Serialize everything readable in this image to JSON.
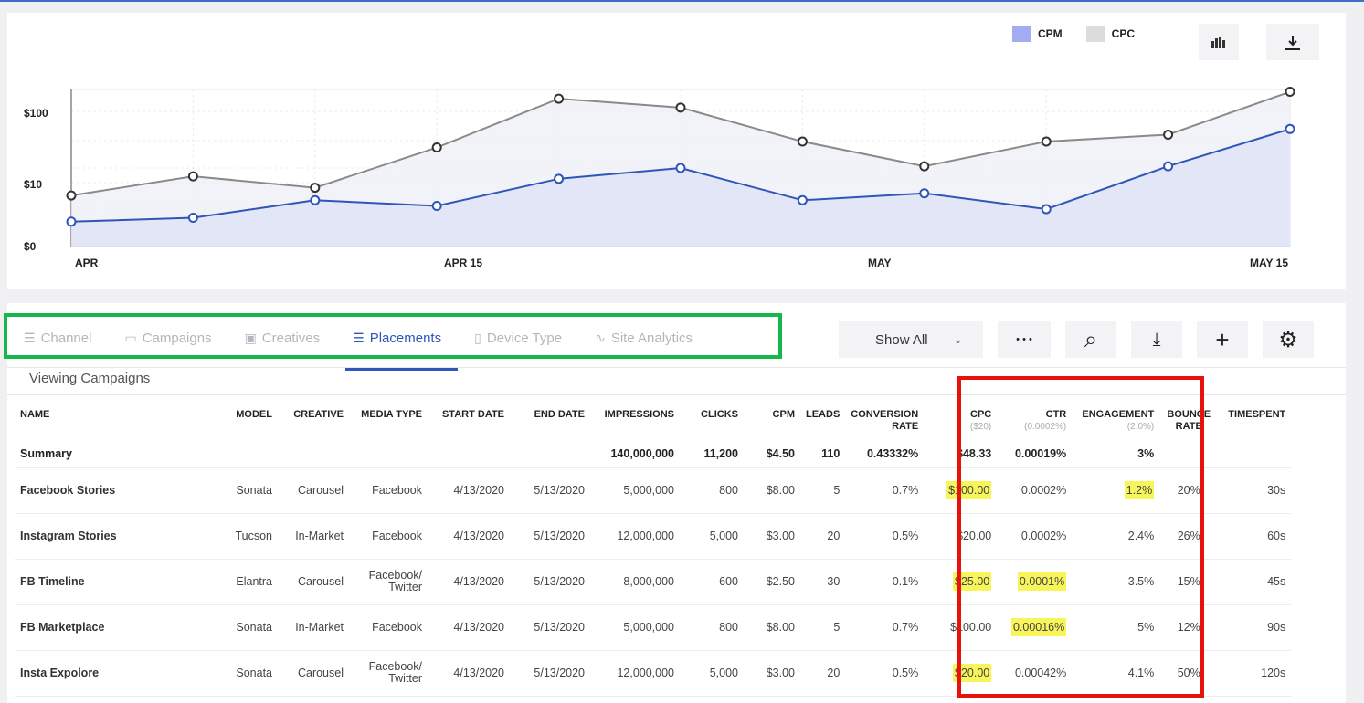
{
  "legend": [
    {
      "label": "CPM",
      "color": "#a3acf0"
    },
    {
      "label": "CPC",
      "color": "#dcdcdc"
    }
  ],
  "chart_data": {
    "type": "area",
    "x_labels": [
      "APR",
      "APR 15",
      "MAY",
      "MAY 15"
    ],
    "y_ticks": [
      "$100",
      "$10",
      "$0"
    ],
    "yscale": "log",
    "series": [
      {
        "name": "CPM",
        "color": "#2f55b8",
        "values": [
          3,
          3.4,
          6,
          5,
          12,
          17,
          6,
          7.5,
          4.5,
          18,
          60
        ]
      },
      {
        "name": "CPC",
        "color": "#8a8a8a",
        "values": [
          7,
          13,
          9,
          33,
          160,
          120,
          40,
          18,
          40,
          50,
          200
        ]
      }
    ]
  },
  "tabs": [
    {
      "label": "Channel",
      "icon": "list-icon"
    },
    {
      "label": "Campaigns",
      "icon": "folder-icon"
    },
    {
      "label": "Creatives",
      "icon": "image-icon"
    },
    {
      "label": "Placements",
      "icon": "list-icon",
      "active": true
    },
    {
      "label": "Device Type",
      "icon": "phone-icon"
    },
    {
      "label": "Site Analytics",
      "icon": "analytics-icon"
    }
  ],
  "toolbar": {
    "show_all": "Show All",
    "chevron": "⌄",
    "more": "• • •",
    "search": "⌕",
    "download": "⤓",
    "add": "+",
    "settings": "⚙"
  },
  "viewing": "Viewing Campaigns",
  "columns": {
    "name": "NAME",
    "model": "MODEL",
    "creative": "CREATIVE",
    "media": "MEDIA TYPE",
    "start": "START DATE",
    "end": "END DATE",
    "impressions": "IMPRESSIONS",
    "clicks": "CLICKS",
    "cpm": "CPM",
    "leads": "LEADS",
    "conv1": "CONVERSION",
    "conv2": "RATE",
    "cpc": "CPC",
    "cpc_sub": "($20)",
    "ctr": "CTR",
    "ctr_sub": "(0.0002%)",
    "eng": "ENGAGEMENT",
    "eng_sub": "(2.0%)",
    "bounce1": "BOUNCE",
    "bounce2": "RATE",
    "time": "TIMESPENT"
  },
  "summary": {
    "name": "Summary",
    "impressions": "140,000,000",
    "clicks": "11,200",
    "cpm": "$4.50",
    "leads": "110",
    "conversion": "0.43332%",
    "cpc": "$48.33",
    "ctr": "0.00019%",
    "engagement": "3%"
  },
  "rows": [
    {
      "name": "Facebook Stories",
      "model": "Sonata",
      "creative": "Carousel",
      "media": "Facebook",
      "media2": "",
      "start": "4/13/2020",
      "end": "5/13/2020",
      "impressions": "5,000,000",
      "clicks": "800",
      "cpm": "$8.00",
      "leads": "5",
      "conversion": "0.7%",
      "cpc": "$100.00",
      "ctr": "0.0002%",
      "engagement": "1.2%",
      "bounce": "20%",
      "time": "30s"
    },
    {
      "name": "Instagram Stories",
      "model": "Tucson",
      "creative": "In-Market",
      "media": "Facebook",
      "media2": "",
      "start": "4/13/2020",
      "end": "5/13/2020",
      "impressions": "12,000,000",
      "clicks": "5,000",
      "cpm": "$3.00",
      "leads": "20",
      "conversion": "0.5%",
      "cpc": "$20.00",
      "ctr": "0.0002%",
      "engagement": "2.4%",
      "bounce": "26%",
      "time": "60s"
    },
    {
      "name": "FB Timeline",
      "model": "Elantra",
      "creative": "Carousel",
      "media": "Facebook/",
      "media2": "Twitter",
      "start": "4/13/2020",
      "end": "5/13/2020",
      "impressions": "8,000,000",
      "clicks": "600",
      "cpm": "$2.50",
      "leads": "30",
      "conversion": "0.1%",
      "cpc": "$25.00",
      "ctr": "0.0001%",
      "engagement": "3.5%",
      "bounce": "15%",
      "time": "45s"
    },
    {
      "name": "FB Marketplace",
      "model": "Sonata",
      "creative": "In-Market",
      "media": "Facebook",
      "media2": "",
      "start": "4/13/2020",
      "end": "5/13/2020",
      "impressions": "5,000,000",
      "clicks": "800",
      "cpm": "$8.00",
      "leads": "5",
      "conversion": "0.7%",
      "cpc": "$100.00",
      "ctr": "0.00016%",
      "engagement": "5%",
      "bounce": "12%",
      "time": "90s"
    },
    {
      "name": "Insta Expolore",
      "model": "Sonata",
      "creative": "Carousel",
      "media": "Facebook/",
      "media2": "Twitter",
      "start": "4/13/2020",
      "end": "5/13/2020",
      "impressions": "12,000,000",
      "clicks": "5,000",
      "cpm": "$3.00",
      "leads": "20",
      "conversion": "0.5%",
      "cpc": "$20.00",
      "ctr": "0.00042%",
      "engagement": "4.1%",
      "bounce": "50%",
      "time": "120s"
    }
  ],
  "highlights": {
    "0": [
      "cpc",
      "engagement"
    ],
    "2": [
      "cpc",
      "ctr"
    ],
    "3": [
      "ctr"
    ],
    "4": [
      "cpc"
    ]
  }
}
